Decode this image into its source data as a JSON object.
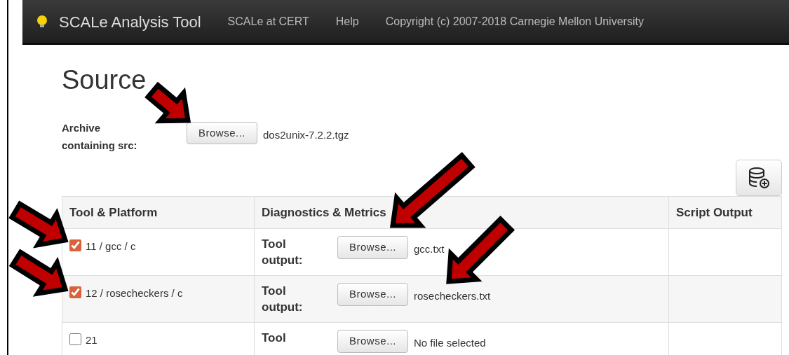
{
  "navbar": {
    "brand": "SCALe Analysis Tool",
    "links": [
      "SCALe at CERT",
      "Help",
      "Copyright (c) 2007-2018 Carnegie Mellon University"
    ]
  },
  "heading": "Source",
  "archive": {
    "label": "Archive containing src:",
    "button": "Browse...",
    "file": "dos2unix-7.2.2.tgz"
  },
  "table": {
    "columns": [
      "Tool & Platform",
      "Diagnostics & Metrics",
      "Script Output"
    ],
    "rows": [
      {
        "tool": "11 / gcc / c",
        "checked": true,
        "label": "Tool output:",
        "button": "Browse...",
        "file": "gcc.txt"
      },
      {
        "tool": "12 / rosecheckers / c",
        "checked": true,
        "label": "Tool output:",
        "button": "Browse...",
        "file": "rosecheckers.txt"
      },
      {
        "tool": "21",
        "checked": false,
        "label": "Tool",
        "button": "Browse...",
        "file": "No file selected"
      }
    ]
  }
}
